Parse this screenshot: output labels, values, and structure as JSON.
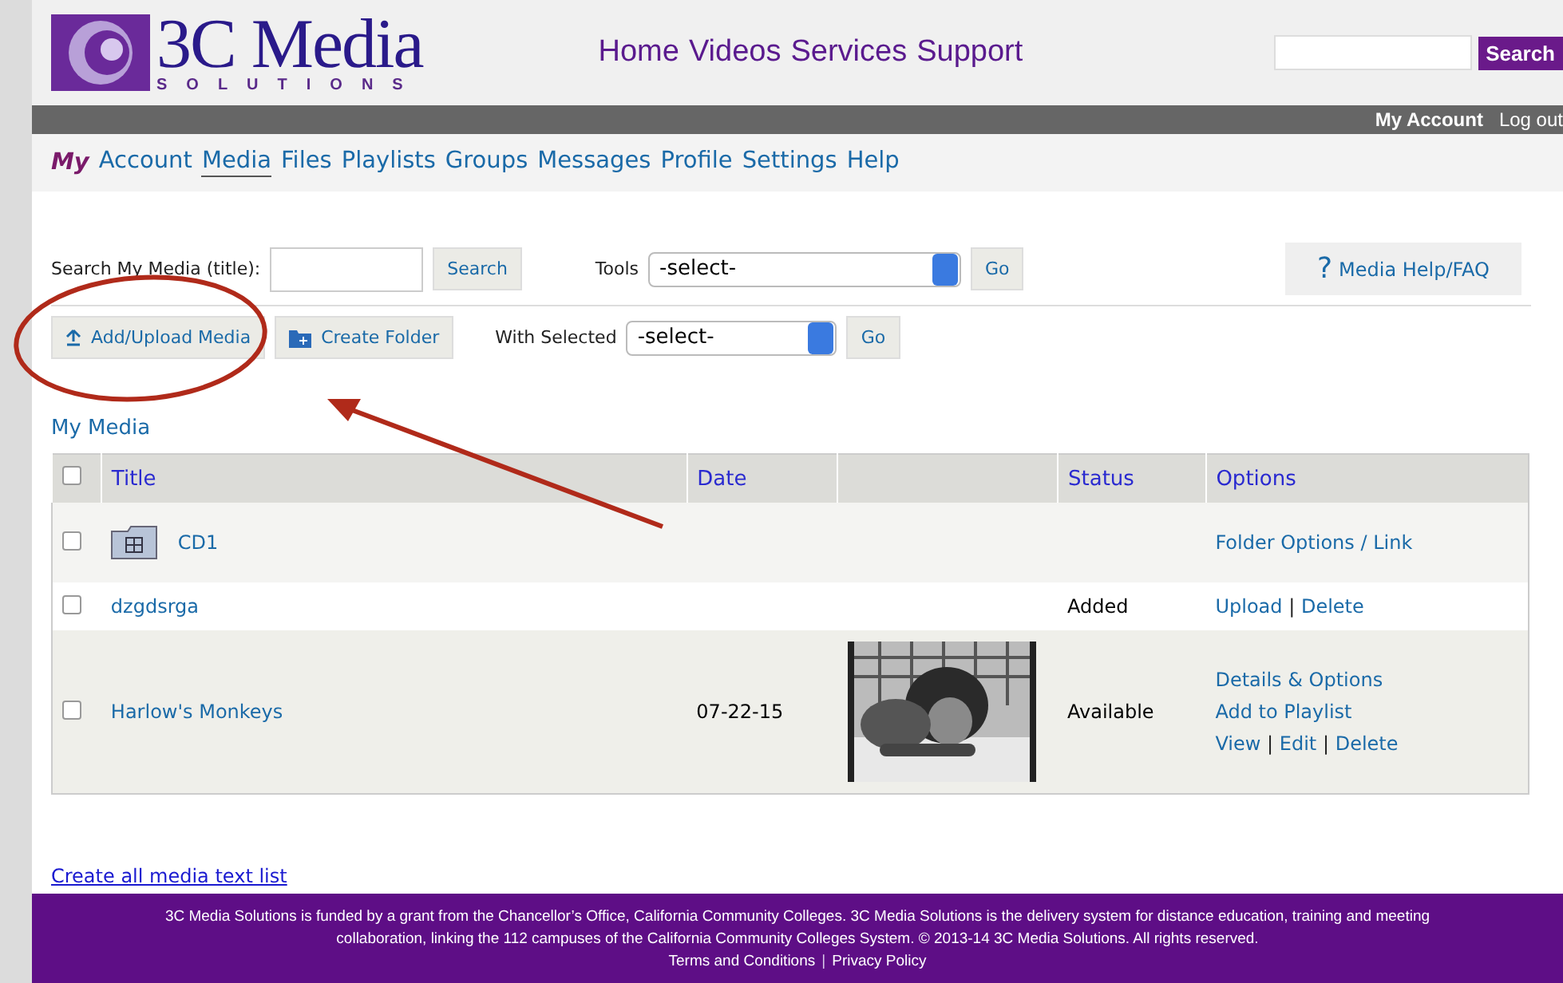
{
  "header": {
    "logo_main": "3C Media",
    "logo_sub": "SOLUTIONS",
    "nav": [
      "Home",
      "Videos",
      "Services",
      "Support"
    ],
    "search_button": "Search"
  },
  "account_bar": {
    "account": "My Account",
    "logout": "Log out"
  },
  "tabs": {
    "prefix": "My",
    "items": [
      {
        "label": "Account",
        "selected": false
      },
      {
        "label": "Media",
        "selected": true
      },
      {
        "label": "Files",
        "selected": false
      },
      {
        "label": "Playlists",
        "selected": false
      },
      {
        "label": "Groups",
        "selected": false
      },
      {
        "label": "Messages",
        "selected": false
      },
      {
        "label": "Profile",
        "selected": false
      },
      {
        "label": "Settings",
        "selected": false
      },
      {
        "label": "Help",
        "selected": false
      }
    ]
  },
  "toolbar": {
    "search_label": "Search My Media (title):",
    "search_button": "Search",
    "tools_label": "Tools",
    "tools_value": "-select-",
    "go": "Go",
    "help_mark": "?",
    "help": "Media Help/FAQ",
    "upload": "Add/Upload Media",
    "create_folder": "Create Folder",
    "with_selected_label": "With Selected",
    "with_selected_value": "-select-",
    "go2": "Go"
  },
  "section_title": "My Media",
  "table": {
    "select_all_checked": false,
    "columns": [
      "Title",
      "Date",
      "",
      "Status",
      "Options"
    ],
    "rows": [
      {
        "kind": "folder",
        "title": "CD1",
        "date": "",
        "status": "",
        "checked": false,
        "options": [
          [
            {
              "kind": "link",
              "text": "Folder Options / Link"
            }
          ]
        ]
      },
      {
        "kind": "media",
        "title": "dzgdsrga",
        "date": "",
        "status": "Added",
        "checked": false,
        "options": [
          [
            {
              "kind": "link",
              "text": "Upload"
            },
            {
              "kind": "sep",
              "text": "|"
            },
            {
              "kind": "link",
              "text": "Delete"
            }
          ]
        ]
      },
      {
        "kind": "video",
        "title": "Harlow's Monkeys",
        "date": "07-22-15",
        "status": "Available",
        "checked": false,
        "thumbnail": {
          "kind": "picture"
        },
        "options": [
          [
            {
              "kind": "link",
              "text": "Details & Options"
            }
          ],
          [
            {
              "kind": "link",
              "text": "Add to Playlist"
            }
          ],
          [
            {
              "kind": "link",
              "text": "View"
            },
            {
              "kind": "sep",
              "text": "|"
            },
            {
              "kind": "link",
              "text": "Edit"
            },
            {
              "kind": "sep",
              "text": "|"
            },
            {
              "kind": "link",
              "text": "Delete"
            }
          ]
        ]
      }
    ]
  },
  "text_list_link": "Create all media text list",
  "footer": {
    "text": "3C Media Solutions is funded by a grant from the Chancellor’s Office, California Community Colleges. 3C Media Solutions is the delivery system for distance education, training and meeting collaboration, linking the 112 campuses of the California Community Colleges System. © 2013-14 3C Media Solutions. All rights reserved.",
    "links": [
      {
        "kind": "link",
        "text": "Terms and Conditions"
      },
      {
        "kind": "sep",
        "text": "|"
      },
      {
        "kind": "link",
        "text": "Privacy Policy"
      }
    ]
  }
}
